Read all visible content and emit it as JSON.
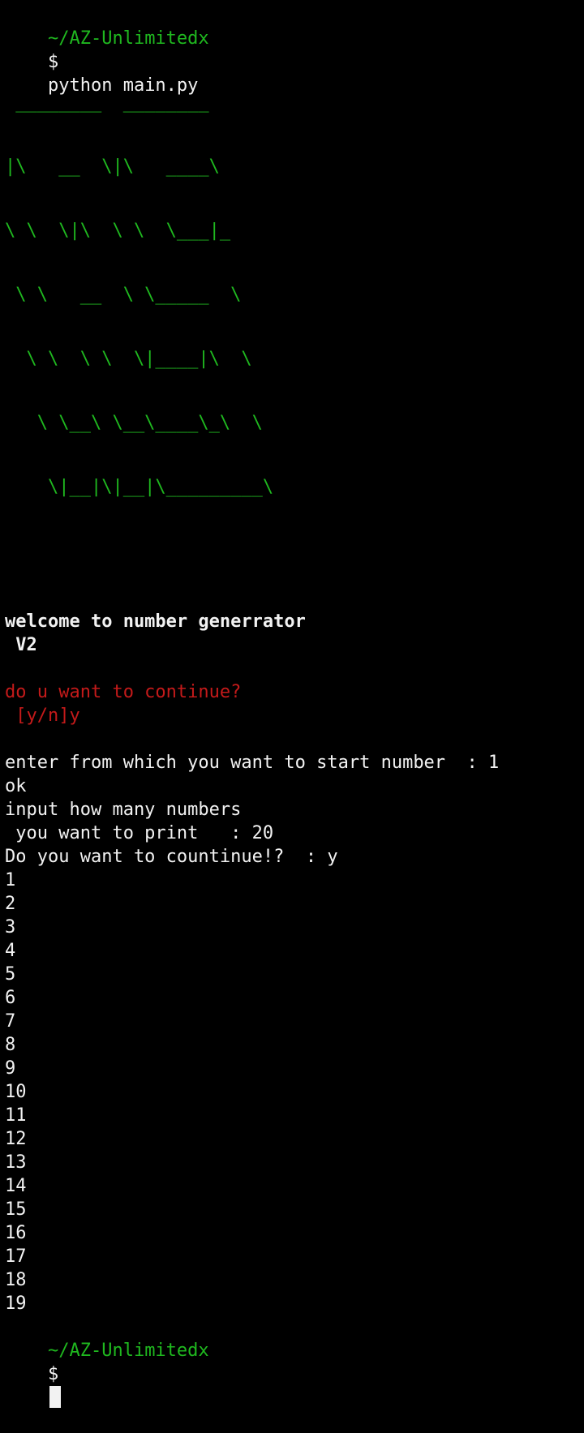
{
  "prompt": {
    "path": "~/AZ-Unlimitedx",
    "symbol": "$",
    "command": "python main.py"
  },
  "ascii_banner": [
    " ________  ________",
    "|\\   __  \\|\\   ____\\",
    "\\ \\  \\|\\  \\ \\  \\___|_",
    " \\ \\   __  \\ \\_____  \\",
    "  \\ \\  \\ \\  \\|____|\\  \\",
    "   \\ \\__\\ \\__\\____\\_\\  \\",
    "    \\|__|\\|__|\\_________\\"
  ],
  "welcome": {
    "line1": "welcome to number generrator",
    "line2": " V2"
  },
  "continue_prompt": {
    "line1": "do u want to continue?",
    "line2": " [y/n]",
    "answer": "y"
  },
  "output_lines": [
    "enter from which you want to start number  : 1",
    "ok",
    "input how many numbers",
    " you want to print   : 20",
    "Do you want to countinue!?  : y"
  ],
  "numbers": [
    "1",
    "2",
    "3",
    "4",
    "5",
    "6",
    "7",
    "8",
    "9",
    "10",
    "11",
    "12",
    "13",
    "14",
    "15",
    "16",
    "17",
    "18",
    "19"
  ],
  "colors": {
    "background": "#000000",
    "prompt_green": "#1fb81f",
    "warning_red": "#c41a1a",
    "text": "#f2f2f2"
  }
}
